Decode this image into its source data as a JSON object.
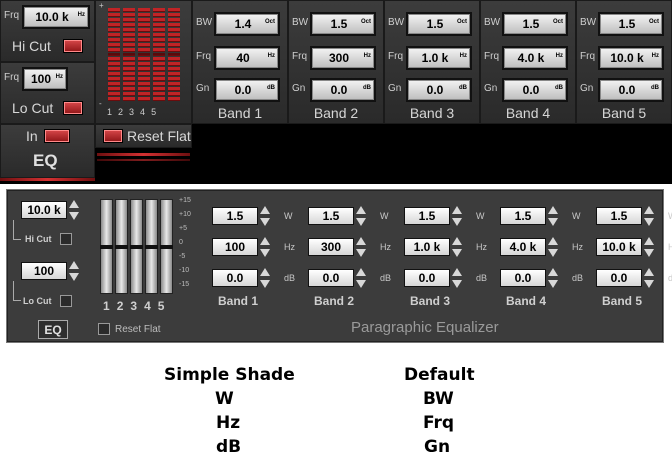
{
  "top": {
    "hi": {
      "frq_label": "Frq",
      "value": "10.0 k",
      "unit": "Hz",
      "cut_label": "Hi Cut"
    },
    "lo": {
      "frq_label": "Frq",
      "value": "100",
      "unit": "Hz",
      "cut_label": "Lo Cut"
    },
    "in_label": "In",
    "eq_label": "EQ",
    "fader_scale_plus": "+",
    "fader_scale_minus": "-",
    "fader_numbers": [
      "1",
      "2",
      "3",
      "4",
      "5"
    ],
    "reset_label": "Reset Flat",
    "row_labels": {
      "bw": "BW",
      "frq": "Frq",
      "gn": "Gn"
    },
    "units": {
      "bw": "Oct",
      "frq": "Hz",
      "gn": "dB"
    },
    "bands": [
      {
        "name": "Band 1",
        "bw": "1.4",
        "frq": "40",
        "gn": "0.0"
      },
      {
        "name": "Band 2",
        "bw": "1.5",
        "frq": "300",
        "gn": "0.0"
      },
      {
        "name": "Band 3",
        "bw": "1.5",
        "frq": "1.0 k",
        "gn": "0.0"
      },
      {
        "name": "Band 4",
        "bw": "1.5",
        "frq": "4.0 k",
        "gn": "0.0"
      },
      {
        "name": "Band 5",
        "bw": "1.5",
        "frq": "10.0 k",
        "gn": "0.0"
      }
    ]
  },
  "mid": {
    "hi_value": "10.0 k",
    "hi_cut_label": "Hi Cut",
    "lo_value": "100",
    "lo_cut_label": "Lo Cut",
    "eq_label": "EQ",
    "reset_label": "Reset Flat",
    "scale": [
      "+15",
      "+10",
      "+5",
      "0",
      "-5",
      "-10",
      "-15"
    ],
    "fader_numbers": [
      "1",
      "2",
      "3",
      "4",
      "5"
    ],
    "unit_labels": {
      "w": "W",
      "hz": "Hz",
      "db": "dB"
    },
    "bands": [
      {
        "name": "Band 1",
        "w": "1.5",
        "hz": "100",
        "db": "0.0"
      },
      {
        "name": "Band 2",
        "w": "1.5",
        "hz": "300",
        "db": "0.0"
      },
      {
        "name": "Band 3",
        "w": "1.5",
        "hz": "1.0 k",
        "db": "0.0"
      },
      {
        "name": "Band 4",
        "w": "1.5",
        "hz": "4.0 k",
        "db": "0.0"
      },
      {
        "name": "Band 5",
        "w": "1.5",
        "hz": "10.0 k",
        "db": "0.0"
      }
    ],
    "title": "Paragraphic Equalizer"
  },
  "legend": {
    "col1": [
      "Simple Shade",
      "W",
      "Hz",
      "dB"
    ],
    "col2": [
      "Default",
      "BW",
      "Frq",
      "Gn"
    ]
  }
}
